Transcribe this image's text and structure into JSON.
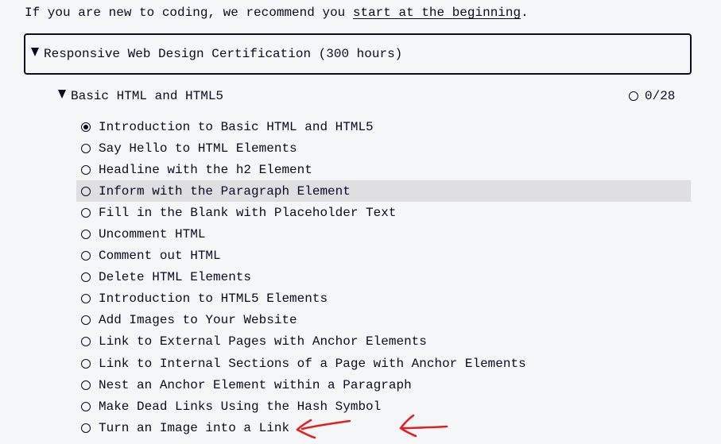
{
  "intro": {
    "prefix": "If you are new to coding, we recommend you ",
    "link": "start at the beginning",
    "suffix": "."
  },
  "certification": {
    "title": "Responsive Web Design Certification (300 hours)",
    "expanded": true
  },
  "block": {
    "title": "Basic HTML and HTML5",
    "progress": "0/28",
    "expanded": true
  },
  "lessons": [
    {
      "label": "Introduction to Basic HTML and HTML5",
      "completed": true
    },
    {
      "label": "Say Hello to HTML Elements",
      "completed": false
    },
    {
      "label": "Headline with the h2 Element",
      "completed": false
    },
    {
      "label": "Inform with the Paragraph Element",
      "completed": false,
      "highlighted": true
    },
    {
      "label": "Fill in the Blank with Placeholder Text",
      "completed": false
    },
    {
      "label": "Uncomment HTML",
      "completed": false
    },
    {
      "label": "Comment out HTML",
      "completed": false
    },
    {
      "label": "Delete HTML Elements",
      "completed": false
    },
    {
      "label": "Introduction to HTML5 Elements",
      "completed": false
    },
    {
      "label": "Add Images to Your Website",
      "completed": false
    },
    {
      "label": "Link to External Pages with Anchor Elements",
      "completed": false
    },
    {
      "label": "Link to Internal Sections of a Page with Anchor Elements",
      "completed": false
    },
    {
      "label": "Nest an Anchor Element within a Paragraph",
      "completed": false
    },
    {
      "label": "Make Dead Links Using the Hash Symbol",
      "completed": false
    },
    {
      "label": "Turn an Image into a Link",
      "completed": false,
      "annotated": true
    }
  ],
  "colors": {
    "background": "#f5f6f7",
    "text": "#0a0a23",
    "hover_row": "#dfdfe2",
    "annotation_arrow": "#e02020"
  },
  "icons": {
    "collapse": "triangle-down-icon",
    "incomplete": "circle-outline-icon",
    "complete": "circle-dot-icon",
    "annotation": "red-arrow-icon"
  }
}
